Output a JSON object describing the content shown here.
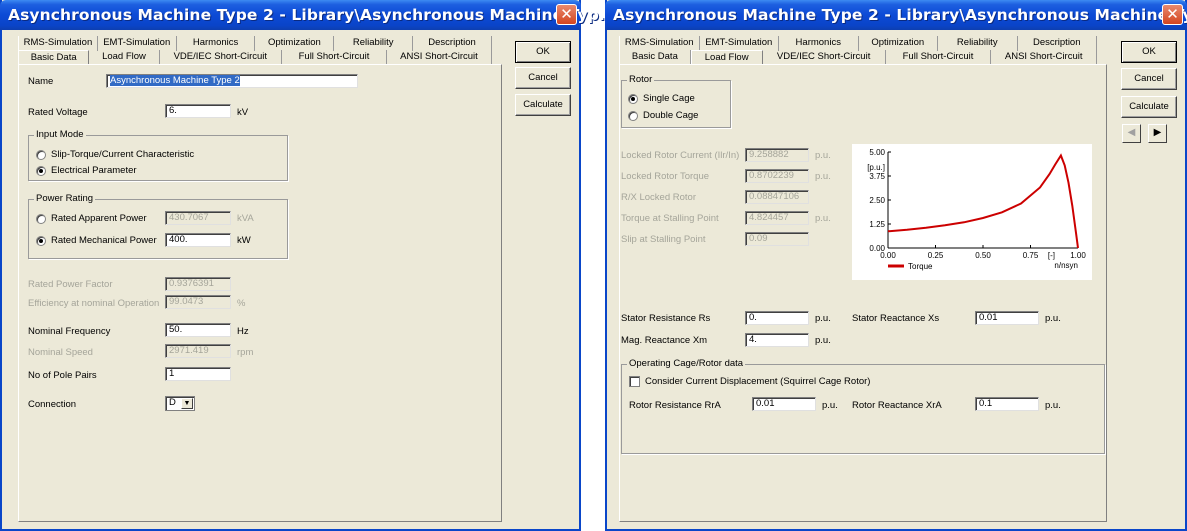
{
  "window_left": {
    "title": "Asynchronous Machine Type 2 - Library\\Asynchronous Machine Typ...",
    "close_glyph": "✕",
    "tabs_top": [
      "RMS-Simulation",
      "EMT-Simulation",
      "Harmonics",
      "Optimization",
      "Reliability",
      "Description"
    ],
    "tabs_bottom": [
      "Basic Data",
      "Load Flow",
      "VDE/IEC Short-Circuit",
      "Full Short-Circuit",
      "ANSI Short-Circuit"
    ],
    "active_tab": "Basic Data",
    "buttons": {
      "ok": "OK",
      "cancel": "Cancel",
      "calculate": "Calculate"
    },
    "name": {
      "label": "Name",
      "value": "Asynchronous Machine Type 2"
    },
    "rated_voltage": {
      "label": "Rated Voltage",
      "value": "6.",
      "unit": "kV"
    },
    "input_mode": {
      "title": "Input Mode",
      "option1": "Slip-Torque/Current Characteristic",
      "option2": "Electrical Parameter",
      "selected": 2
    },
    "power_rating": {
      "title": "Power Rating",
      "apparent_label": "Rated Apparent Power",
      "apparent_value": "430.7067",
      "apparent_unit": "kVA",
      "mechanical_label": "Rated Mechanical Power",
      "mechanical_value": "400.",
      "mechanical_unit": "kW",
      "selected": 2
    },
    "rated_power_factor": {
      "label": "Rated Power Factor",
      "value": "0.9376391"
    },
    "efficiency": {
      "label": "Efficiency at nominal Operation",
      "value": "99.0473",
      "unit": "%"
    },
    "nominal_frequency": {
      "label": "Nominal Frequency",
      "value": "50.",
      "unit": "Hz"
    },
    "nominal_speed": {
      "label": "Nominal Speed",
      "value": "2971.419",
      "unit": "rpm"
    },
    "pole_pairs": {
      "label": "No of Pole Pairs",
      "value": "1"
    },
    "connection": {
      "label": "Connection",
      "value": "D"
    }
  },
  "window_right": {
    "title": "Asynchronous Machine Type 2 - Library\\Asynchronous Machine Typ...",
    "close_glyph": "✕",
    "tabs_top": [
      "RMS-Simulation",
      "EMT-Simulation",
      "Harmonics",
      "Optimization",
      "Reliability",
      "Description"
    ],
    "tabs_bottom": [
      "Basic Data",
      "Load Flow",
      "VDE/IEC Short-Circuit",
      "Full Short-Circuit",
      "ANSI Short-Circuit"
    ],
    "active_tab": "Load Flow",
    "buttons": {
      "ok": "OK",
      "cancel": "Cancel",
      "calculate": "Calculate",
      "prev": "◀",
      "next": "▶"
    },
    "rotor": {
      "title": "Rotor",
      "option1": "Single Cage",
      "option2": "Double Cage",
      "selected": 1
    },
    "locked_rotor_current": {
      "label": "Locked Rotor Current (Ilr/In)",
      "value": "9.258882",
      "unit": "p.u."
    },
    "locked_rotor_torque": {
      "label": "Locked Rotor Torque",
      "value": "0.8702239",
      "unit": "p.u."
    },
    "rx_locked_rotor": {
      "label": "R/X Locked Rotor",
      "value": "0.08847106"
    },
    "torque_stalling": {
      "label": "Torque at Stalling Point",
      "value": "4.824457",
      "unit": "p.u."
    },
    "slip_stalling": {
      "label": "Slip at Stalling Point",
      "value": "0.09"
    },
    "stator_resistance": {
      "label": "Stator Resistance Rs",
      "value": "0.",
      "unit": "p.u."
    },
    "stator_reactance": {
      "label": "Stator Reactance Xs",
      "value": "0.01",
      "unit": "p.u."
    },
    "mag_reactance": {
      "label": "Mag. Reactance Xm",
      "value": "4.",
      "unit": "p.u."
    },
    "operating_cage": {
      "title": "Operating Cage/Rotor data",
      "checkbox_label": "Consider Current Displacement (Squirrel Cage Rotor)",
      "checked": false,
      "rotor_resistance_label": "Rotor Resistance RrA",
      "rotor_resistance_value": "0.01",
      "rotor_resistance_unit": "p.u.",
      "rotor_reactance_label": "Rotor Reactance XrA",
      "rotor_reactance_value": "0.1",
      "rotor_reactance_unit": "p.u."
    }
  },
  "chart_data": {
    "type": "line",
    "title": "",
    "ylabel": "[p.u.]",
    "xlabel": "n/nsyn",
    "x_unit_label": "[-]",
    "xlim": [
      0.0,
      1.0
    ],
    "ylim": [
      0.0,
      5.0
    ],
    "x_ticks": [
      "0.00",
      "0.25",
      "0.50",
      "0.75",
      "1.00"
    ],
    "y_ticks": [
      "0.00",
      "1.25",
      "2.50",
      "3.75",
      "5.00"
    ],
    "legend": "bottom",
    "series": [
      {
        "name": "Torque",
        "color": "#cc0000",
        "x": [
          0.0,
          0.1,
          0.2,
          0.3,
          0.4,
          0.5,
          0.6,
          0.7,
          0.8,
          0.85,
          0.88,
          0.91,
          0.93,
          0.95,
          0.97,
          0.99,
          1.0
        ],
        "y": [
          0.87,
          0.95,
          1.05,
          1.18,
          1.34,
          1.56,
          1.86,
          2.32,
          3.15,
          3.85,
          4.35,
          4.82,
          4.3,
          3.4,
          2.2,
          0.75,
          0.0
        ]
      }
    ]
  }
}
